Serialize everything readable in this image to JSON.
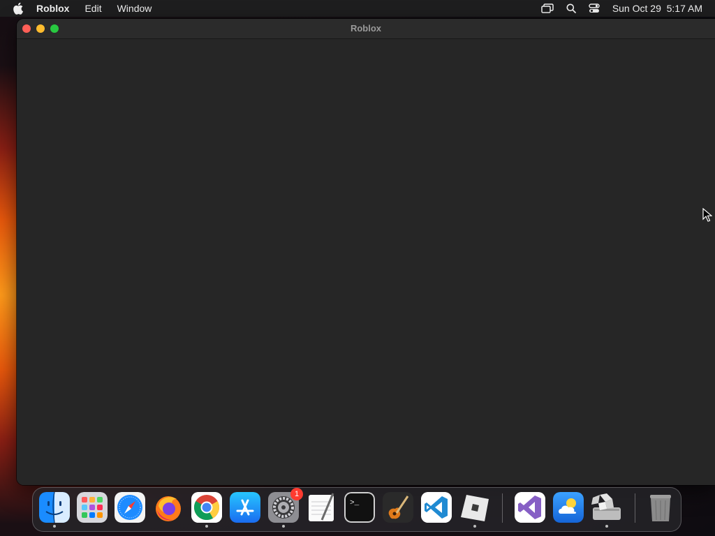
{
  "menubar": {
    "app_name": "Roblox",
    "menus": [
      "Edit",
      "Window"
    ],
    "datetime": "Sun Oct 29  5:17 AM",
    "status_icons": [
      "screen-mirroring-icon",
      "search-icon",
      "control-center-icon"
    ]
  },
  "window": {
    "title": "Roblox"
  },
  "dock": {
    "items": [
      {
        "name": "Finder",
        "icon": "finder-icon",
        "running": true
      },
      {
        "name": "Launchpad",
        "icon": "launchpad-icon",
        "running": false
      },
      {
        "name": "Safari",
        "icon": "safari-icon",
        "running": false
      },
      {
        "name": "Firefox",
        "icon": "firefox-icon",
        "running": false
      },
      {
        "name": "Google Chrome",
        "icon": "chrome-icon",
        "running": true
      },
      {
        "name": "App Store",
        "icon": "app-store-icon",
        "running": false
      },
      {
        "name": "System Settings",
        "icon": "system-settings-icon",
        "running": true,
        "badge": "1"
      },
      {
        "name": "TextEdit",
        "icon": "textedit-icon",
        "running": false
      },
      {
        "name": "Terminal",
        "icon": "terminal-icon",
        "running": false
      },
      {
        "name": "GarageBand",
        "icon": "garageband-icon",
        "running": false
      },
      {
        "name": "Visual Studio Code",
        "icon": "vscode-icon",
        "running": false
      },
      {
        "name": "Roblox",
        "icon": "roblox-icon",
        "running": true
      },
      {
        "name": "Visual Studio",
        "icon": "visual-studio-icon",
        "running": false
      },
      {
        "name": "Weather",
        "icon": "weather-icon",
        "running": false
      },
      {
        "name": "Boot Camp Assistant",
        "icon": "bootcamp-icon",
        "running": true
      },
      {
        "name": "Trash",
        "icon": "trash-icon",
        "running": false
      }
    ]
  }
}
